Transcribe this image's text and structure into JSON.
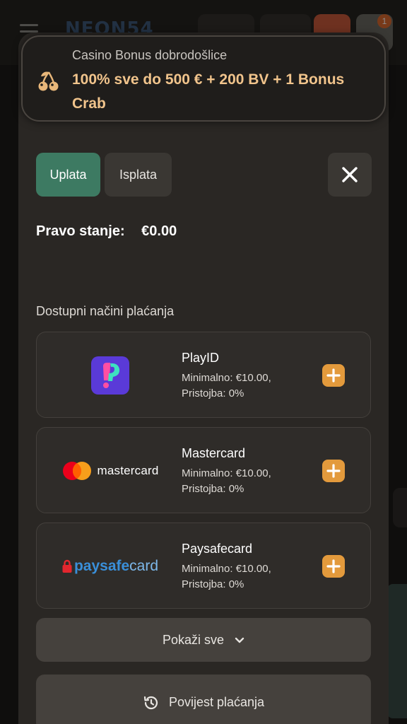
{
  "background": {
    "logo": "NEON54",
    "notification_count": "1"
  },
  "bonus": {
    "subtitle": "Casino Bonus dobrodošlice",
    "title": "100% sve do 500 € + 200 BV + 1 Bonus Crab",
    "icon": "cherries-icon"
  },
  "tabs": [
    {
      "label": "Uplata",
      "active": true
    },
    {
      "label": "Isplata",
      "active": false
    }
  ],
  "balance": {
    "label": "Pravo stanje:",
    "value": "€0.00"
  },
  "methods_title": "Dostupni načini plaćanja",
  "methods": [
    {
      "name": "PlayID",
      "min": "Minimalno: €10.00,",
      "fee": "Pristojba: 0%",
      "logo": "playid-logo"
    },
    {
      "name": "Mastercard",
      "min": "Minimalno: €10.00,",
      "fee": "Pristojba: 0%",
      "logo": "mastercard-logo",
      "logo_text": "mastercard"
    },
    {
      "name": "Paysafecard",
      "min": "Minimalno: €10.00,",
      "fee": "Pristojba: 0%",
      "logo": "paysafecard-logo",
      "logo_text_a": "paysafe",
      "logo_text_b": "card"
    }
  ],
  "show_all_label": "Pokaži sve",
  "history_label": "Povijest plaćanja",
  "colors": {
    "accent_green": "#3d7a62",
    "accent_orange": "#e39a3c",
    "bonus_text": "#f1c48c"
  }
}
